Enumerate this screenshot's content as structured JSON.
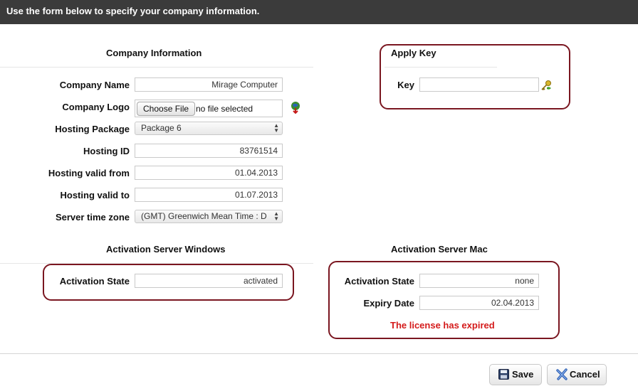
{
  "header": {
    "instruction": "Use the form below to specify your company information."
  },
  "company": {
    "title": "Company Information",
    "name_label": "Company Name",
    "name_value": "Mirage Computer",
    "logo_label": "Company Logo",
    "choose_file_label": "Choose File",
    "no_file_text": "no file selected",
    "package_label": "Hosting Package",
    "package_value": "Package 6",
    "hosting_id_label": "Hosting ID",
    "hosting_id_value": "83761514",
    "valid_from_label": "Hosting valid from",
    "valid_from_value": "01.04.2013",
    "valid_to_label": "Hosting valid to",
    "valid_to_value": "01.07.2013",
    "timezone_label": "Server time zone",
    "timezone_value": "(GMT) Greenwich Mean Time : D"
  },
  "apply_key": {
    "title": "Apply Key",
    "key_label": "Key",
    "key_value": ""
  },
  "activation_windows": {
    "title": "Activation Server Windows",
    "state_label": "Activation State",
    "state_value": "activated"
  },
  "activation_mac": {
    "title": "Activation Server Mac",
    "state_label": "Activation State",
    "state_value": "none",
    "expiry_label": "Expiry Date",
    "expiry_value": "02.04.2013",
    "expired_message": "The license has expired"
  },
  "footer": {
    "save_label": "Save",
    "cancel_label": "Cancel"
  },
  "colors": {
    "box_border": "#7a1620",
    "error_text": "#d41a1a",
    "topbar_bg": "#3b3b3b"
  }
}
